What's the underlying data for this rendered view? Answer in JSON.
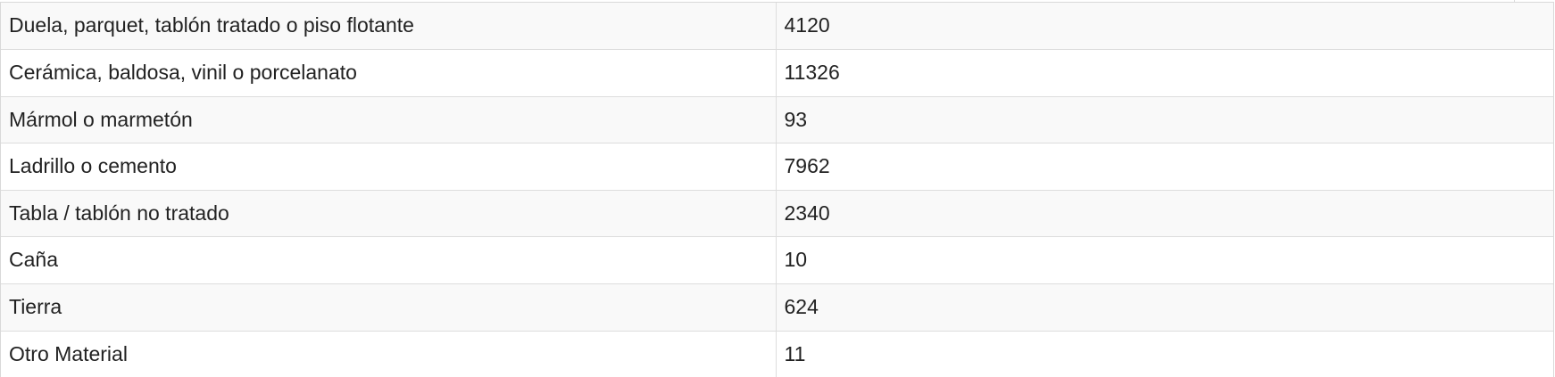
{
  "table": {
    "rows": [
      {
        "label": "Duela, parquet, tablón tratado o piso flotante",
        "value": "4120"
      },
      {
        "label": "Cerámica, baldosa, vinil o porcelanato",
        "value": "11326"
      },
      {
        "label": "Mármol o marmetón",
        "value": "93"
      },
      {
        "label": "Ladrillo o cemento",
        "value": "7962"
      },
      {
        "label": "Tabla / tablón no tratado",
        "value": "2340"
      },
      {
        "label": "Caña",
        "value": "10"
      },
      {
        "label": "Tierra",
        "value": "624"
      },
      {
        "label": "Otro Material",
        "value": "11"
      }
    ]
  }
}
